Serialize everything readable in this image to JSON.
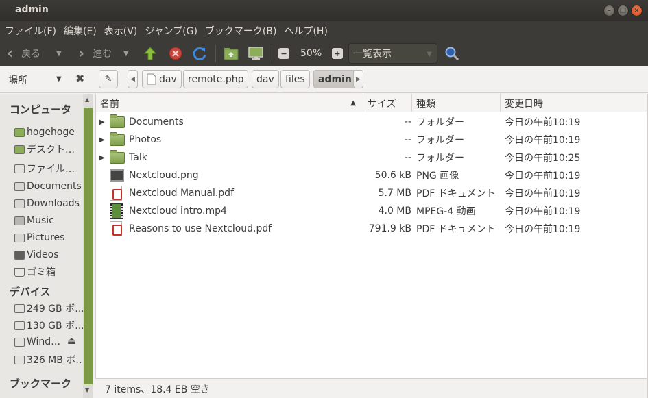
{
  "window": {
    "title": "admin"
  },
  "menu": [
    "ファイル(F)",
    "編集(E)",
    "表示(V)",
    "ジャンプ(G)",
    "ブックマーク(B)",
    "ヘルプ(H)"
  ],
  "toolbar": {
    "back_label": "戻る",
    "forward_label": "進む",
    "zoom": "50%",
    "view_mode": "一覧表示"
  },
  "location": {
    "place_label": "場所",
    "crumbs": [
      "dav",
      "remote.php",
      "dav",
      "files",
      "admin"
    ]
  },
  "sidebar": {
    "computer_header": "コンピュータ",
    "computer_items": [
      "hogehoge",
      "デスクト…",
      "ファイル…",
      "Documents",
      "Downloads",
      "Music",
      "Pictures",
      "Videos",
      "ゴミ箱"
    ],
    "devices_header": "デバイス",
    "device_items": [
      "249 GB ボ…",
      "130 GB ボ…",
      "Wind…",
      "326 MB ボ…"
    ],
    "bookmarks_header": "ブックマーク"
  },
  "columns": {
    "name": "名前",
    "size": "サイズ",
    "type": "種類",
    "modified": "変更日時"
  },
  "files": [
    {
      "name": "Documents",
      "size": "--",
      "type": "フォルダー",
      "modified": "今日の午前10:19",
      "icon": "folder-icon"
    },
    {
      "name": "Photos",
      "size": "--",
      "type": "フォルダー",
      "modified": "今日の午前10:19",
      "icon": "folder-icon"
    },
    {
      "name": "Talk",
      "size": "--",
      "type": "フォルダー",
      "modified": "今日の午前10:25",
      "icon": "folder-icon"
    },
    {
      "name": "Nextcloud.png",
      "size": "50.6 kB",
      "type": "PNG 画像",
      "modified": "今日の午前10:19",
      "icon": "image-file-icon"
    },
    {
      "name": "Nextcloud Manual.pdf",
      "size": "5.7 MB",
      "type": "PDF ドキュメント",
      "modified": "今日の午前10:19",
      "icon": "pdf-file-icon"
    },
    {
      "name": "Nextcloud intro.mp4",
      "size": "4.0 MB",
      "type": "MPEG-4 動画",
      "modified": "今日の午前10:19",
      "icon": "video-file-icon"
    },
    {
      "name": "Reasons to use Nextcloud.pdf",
      "size": "791.9 kB",
      "type": "PDF ドキュメント",
      "modified": "今日の午前10:19",
      "icon": "pdf-file-icon"
    }
  ],
  "status": "7 items、18.4 EB 空き"
}
